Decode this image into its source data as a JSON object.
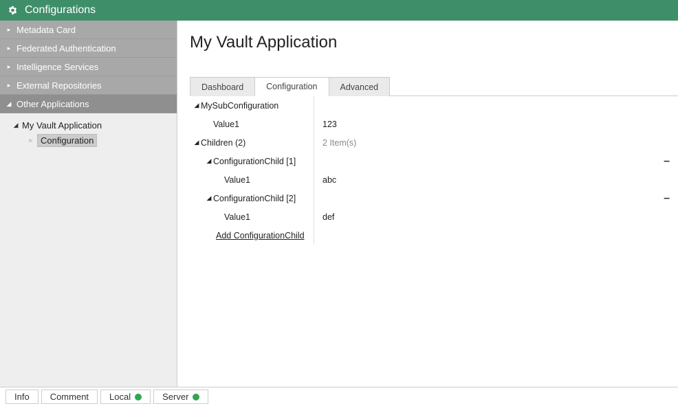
{
  "header": {
    "title": "Configurations"
  },
  "sidebar": {
    "sections": [
      {
        "label": "Metadata Card",
        "expanded": false
      },
      {
        "label": "Federated Authentication",
        "expanded": false
      },
      {
        "label": "Intelligence Services",
        "expanded": false
      },
      {
        "label": "External Repositories",
        "expanded": false
      },
      {
        "label": "Other Applications",
        "expanded": true
      }
    ],
    "tree": {
      "app": {
        "label": "My Vault Application",
        "expanded": true,
        "children": [
          {
            "label": "Configuration",
            "selected": true
          }
        ]
      }
    }
  },
  "main": {
    "title": "My Vault Application",
    "tabs": [
      {
        "label": "Dashboard",
        "active": false
      },
      {
        "label": "Configuration",
        "active": true
      },
      {
        "label": "Advanced",
        "active": false
      }
    ],
    "grid": {
      "remove_glyph": "–",
      "mysub": {
        "label": "MySubConfiguration",
        "value1": {
          "label": "Value1",
          "value": "123"
        }
      },
      "children": {
        "label": "Children (2)",
        "summary": "2 Item(s)",
        "add_label": "Add ConfigurationChild",
        "items": [
          {
            "label": "ConfigurationChild [1]",
            "value1": {
              "label": "Value1",
              "value": "abc"
            }
          },
          {
            "label": "ConfigurationChild [2]",
            "value1": {
              "label": "Value1",
              "value": "def"
            }
          }
        ]
      }
    }
  },
  "status": {
    "info": "Info",
    "comment": "Comment",
    "local": {
      "label": "Local",
      "color": "#2fa84f",
      "dot_style": "background:#2fa84f"
    },
    "server": {
      "label": "Server",
      "color": "#2fa84f",
      "dot_style": "background:#2fa84f"
    }
  }
}
